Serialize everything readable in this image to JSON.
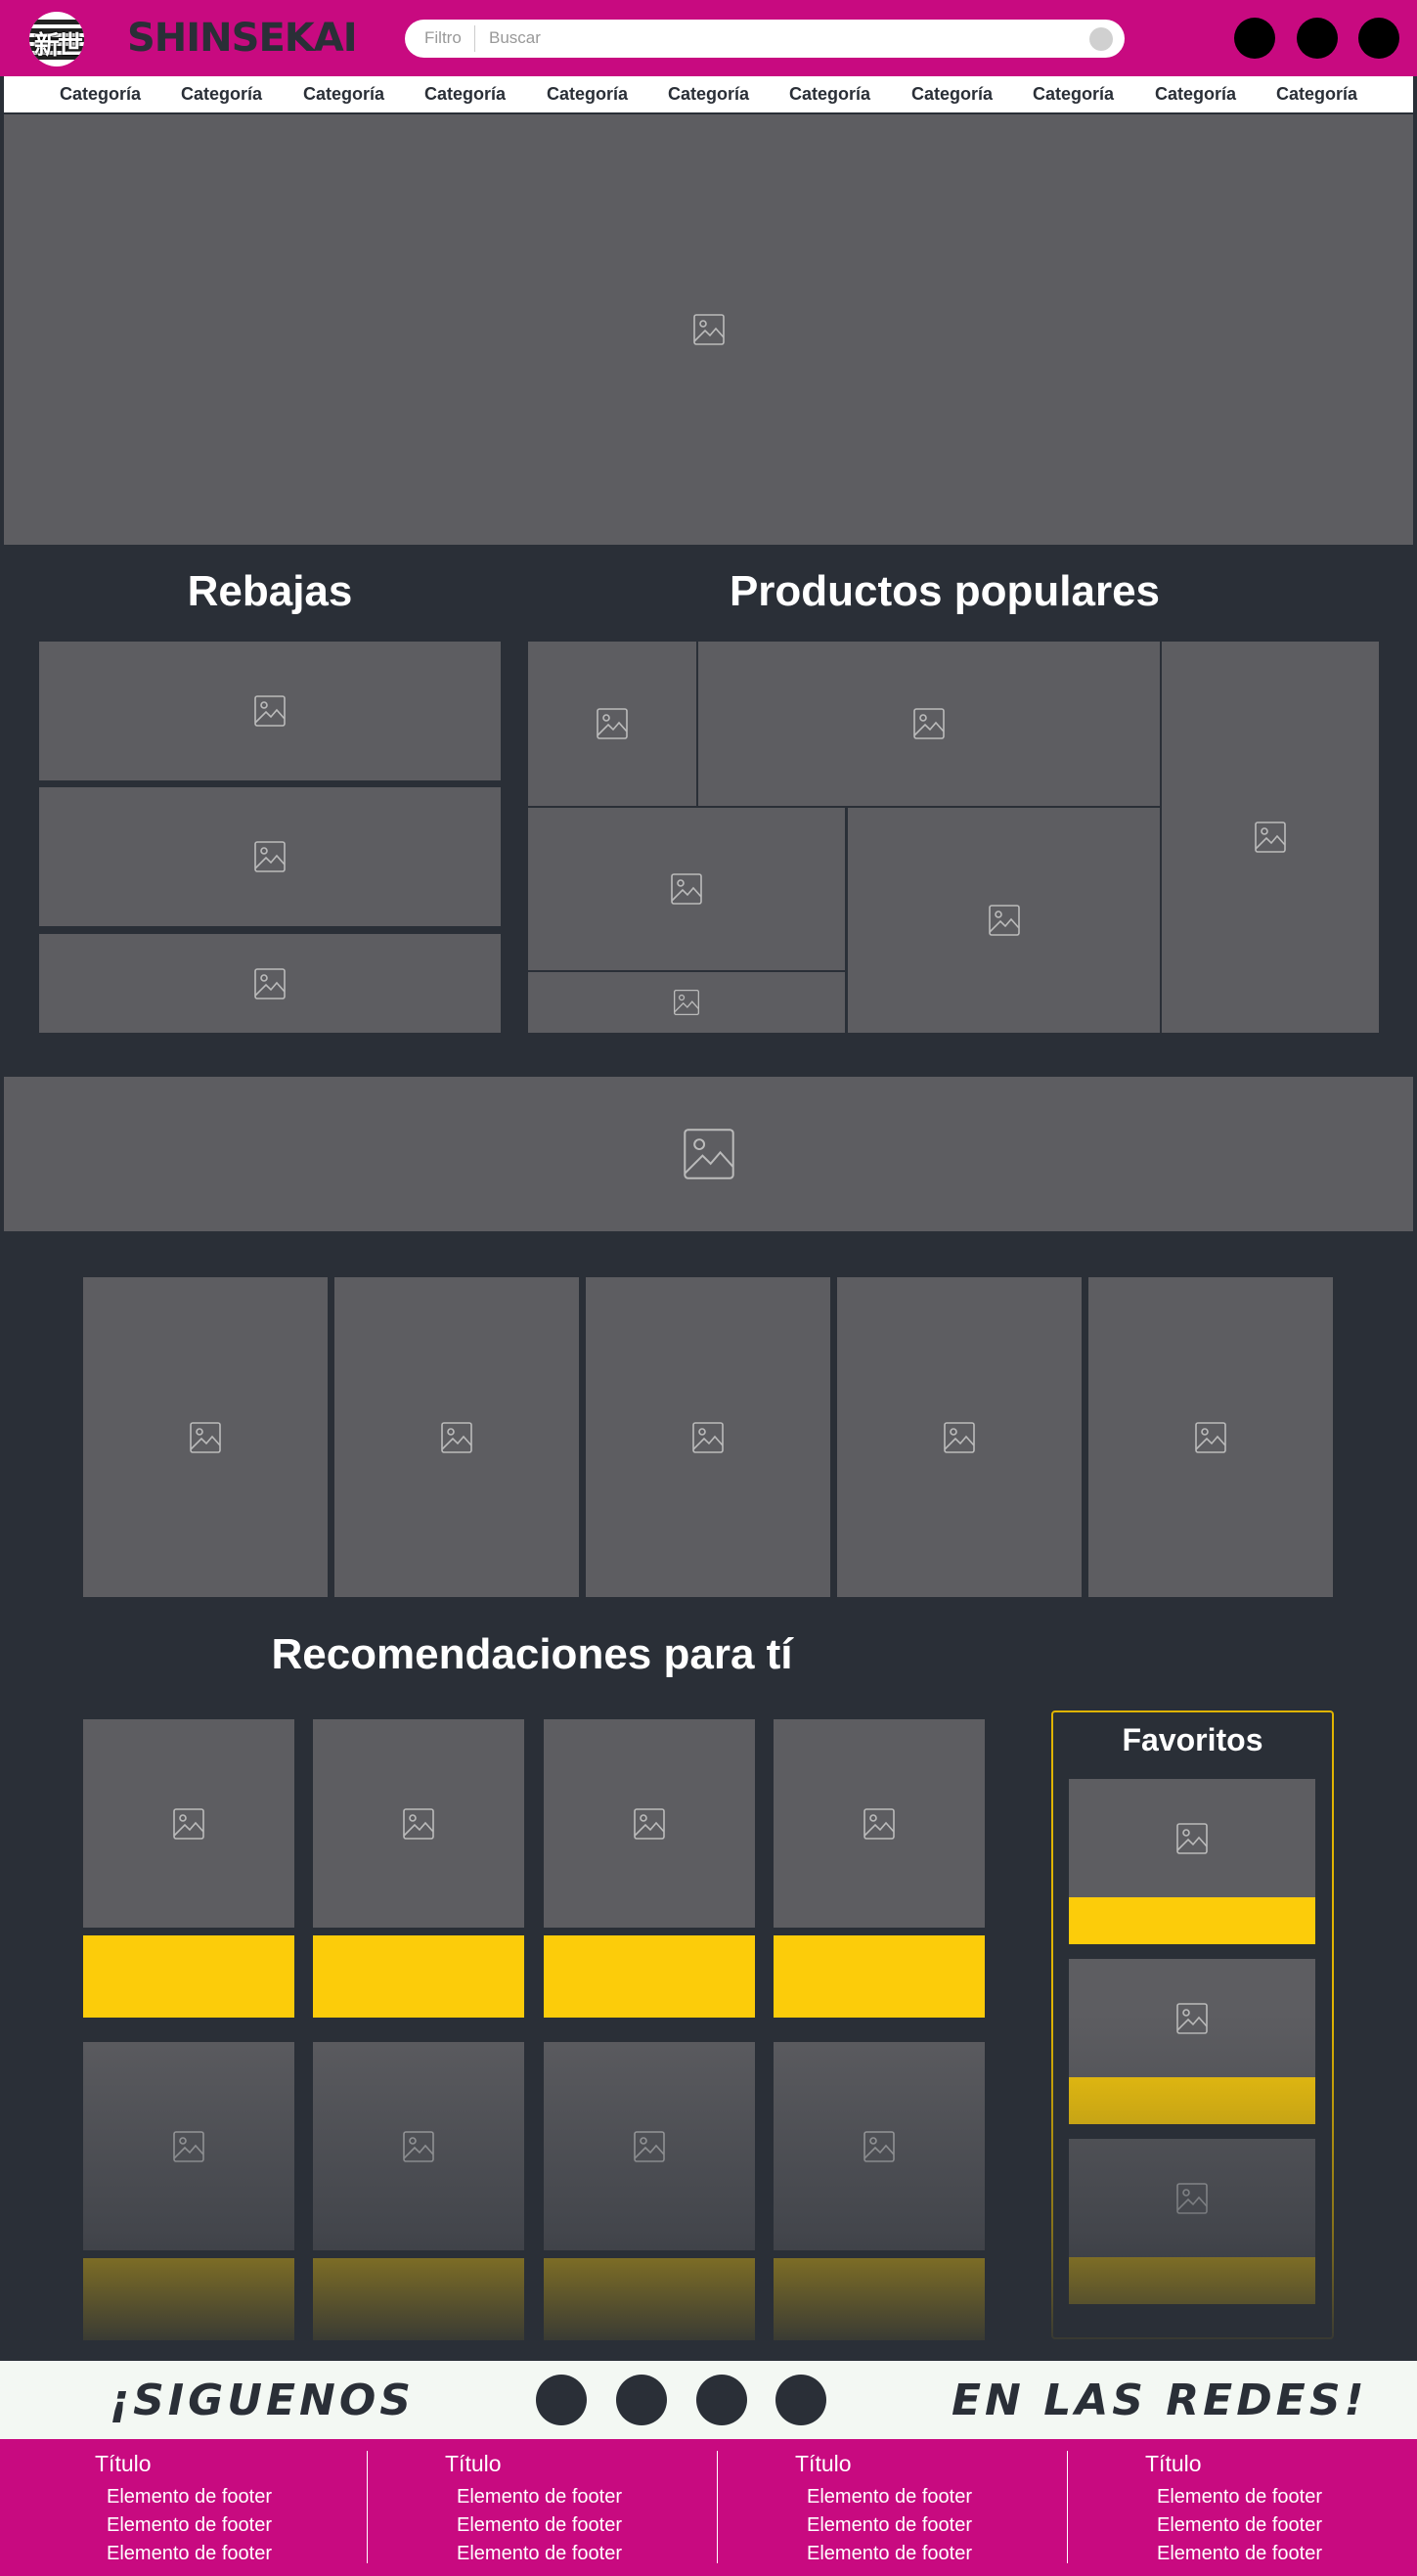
{
  "header": {
    "logo_kanji": "新世界",
    "logo_text": "SHINSEKAI",
    "search": {
      "filter_label": "Filtro",
      "placeholder": "Buscar"
    },
    "icons": [
      "cart-icon",
      "favorites-icon",
      "user-icon"
    ]
  },
  "categories": [
    "Categoría",
    "Categoría",
    "Categoría",
    "Categoría",
    "Categoría",
    "Categoría",
    "Categoría",
    "Categoría",
    "Categoría",
    "Categoría",
    "Categoría"
  ],
  "sections": {
    "sales_title": "Rebajas",
    "popular_title": "Productos populares",
    "recommendations_title": "Recomendaciones para tí",
    "favorites_title": "Favoritos"
  },
  "social": {
    "left_text": "¡SIGUENOS",
    "right_text": "EN LAS REDES!",
    "icons": [
      "social-icon-1",
      "social-icon-2",
      "social-icon-3",
      "social-icon-4"
    ]
  },
  "footer": {
    "columns": [
      {
        "title": "Título",
        "items": [
          "Elemento de footer",
          "Elemento de footer",
          "Elemento de footer"
        ]
      },
      {
        "title": "Título",
        "items": [
          "Elemento de footer",
          "Elemento de footer",
          "Elemento de footer"
        ]
      },
      {
        "title": "Título",
        "items": [
          "Elemento de footer",
          "Elemento de footer",
          "Elemento de footer"
        ]
      },
      {
        "title": "Título",
        "items": [
          "Elemento de footer",
          "Elemento de footer",
          "Elemento de footer"
        ]
      }
    ]
  },
  "colors": {
    "brand_magenta": "#c80a80",
    "background": "#2a2f37",
    "placeholder_gray": "#5d5d61",
    "accent_yellow": "#fccc0a",
    "social_band": "#f3f8f3"
  }
}
